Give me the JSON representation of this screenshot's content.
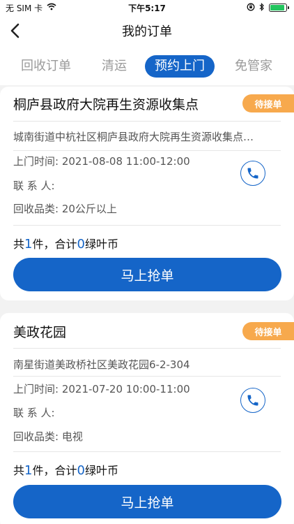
{
  "status_bar": {
    "carrier": "无 SIM 卡",
    "time": "下午5:17",
    "battery_level": 0.9
  },
  "nav": {
    "title": "我的订单"
  },
  "tabs": [
    {
      "label": "回收订单",
      "active": false
    },
    {
      "label": "清运",
      "active": false
    },
    {
      "label": "预约上门",
      "active": true
    },
    {
      "label": "免管家",
      "active": false
    }
  ],
  "orders": [
    {
      "name": "桐庐县政府大院再生资源收集点",
      "status": "待接单",
      "address": "城南街道中杭社区桐庐县政府大院再生资源收集点…",
      "visit_label": "上门时间:",
      "visit_time": "2021-08-08 11:00-12:00",
      "contact_label": "联 系 人:",
      "contact": "",
      "category_label": "回收品类:",
      "category": "20公斤以上",
      "total_prefix": "共",
      "count": "1",
      "total_mid": "件，合计",
      "coins": "0",
      "total_suffix": "绿叶币",
      "button": "马上抢单"
    },
    {
      "name": "美政花园",
      "status": "待接单",
      "address": "南星街道美政桥社区美政花园6-2-304",
      "visit_label": "上门时间:",
      "visit_time": "2021-07-20 10:00-11:00",
      "contact_label": "联 系 人:",
      "contact": "",
      "category_label": "回收品类:",
      "category": "电视",
      "total_prefix": "共",
      "count": "1",
      "total_mid": "件，合计",
      "coins": "0",
      "total_suffix": "绿叶币",
      "button": "马上抢单"
    }
  ],
  "colors": {
    "accent": "#1565c8",
    "badge": "#f7a94d",
    "background": "#f2f2f2"
  }
}
